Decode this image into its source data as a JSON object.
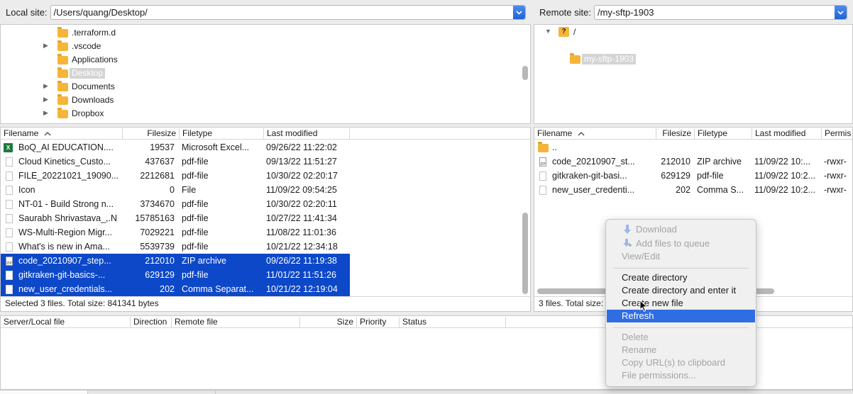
{
  "local": {
    "label": "Local site:",
    "path": "/Users/quang/Desktop/",
    "tree": [
      {
        "name": ".terraform.d",
        "expand": false,
        "selected": false
      },
      {
        "name": ".vscode",
        "expand": true,
        "selected": false
      },
      {
        "name": "Applications",
        "expand": false,
        "selected": false
      },
      {
        "name": "Desktop",
        "expand": false,
        "selected": true
      },
      {
        "name": "Documents",
        "expand": true,
        "selected": false
      },
      {
        "name": "Downloads",
        "expand": true,
        "selected": false
      },
      {
        "name": "Dropbox",
        "expand": true,
        "selected": false
      }
    ],
    "columns": {
      "filename": "Filename",
      "filesize": "Filesize",
      "filetype": "Filetype",
      "modified": "Last modified"
    },
    "files": [
      {
        "name": "BoQ_AI EDUCATION....",
        "size": "19537",
        "type": "Microsoft Excel...",
        "modified": "09/26/22 11:22:02",
        "icon": "excel-icon",
        "selected": false
      },
      {
        "name": "Cloud Kinetics_Custo...",
        "size": "437637",
        "type": "pdf-file",
        "modified": "09/13/22 11:51:27",
        "icon": "file-icon",
        "selected": false
      },
      {
        "name": "FILE_20221021_19090...",
        "size": "2212681",
        "type": "pdf-file",
        "modified": "10/30/22 02:20:17",
        "icon": "file-icon",
        "selected": false
      },
      {
        "name": "Icon",
        "size": "0",
        "type": "File",
        "modified": "11/09/22 09:54:25",
        "icon": "file-icon",
        "selected": false
      },
      {
        "name": "NT-01 - Build Strong n...",
        "size": "3734670",
        "type": "pdf-file",
        "modified": "10/30/22 02:20:11",
        "icon": "file-icon",
        "selected": false
      },
      {
        "name": "Saurabh Shrivastava_,.N",
        "size": "15785163",
        "type": "pdf-file",
        "modified": "10/27/22 11:41:34",
        "icon": "file-icon",
        "selected": false
      },
      {
        "name": "WS-Multi-Region Migr...",
        "size": "7029221",
        "type": "pdf-file",
        "modified": "11/08/22 11:01:36",
        "icon": "file-icon",
        "selected": false
      },
      {
        "name": "What's is new in Ama...",
        "size": "5539739",
        "type": "pdf-file",
        "modified": "10/21/22 12:34:18",
        "icon": "file-icon",
        "selected": false
      },
      {
        "name": "code_20210907_step...",
        "size": "212010",
        "type": "ZIP archive",
        "modified": "09/26/22 11:19:38",
        "icon": "zip-icon",
        "selected": true
      },
      {
        "name": "gitkraken-git-basics-...",
        "size": "629129",
        "type": "pdf-file",
        "modified": "11/01/22 11:51:26",
        "icon": "file-icon",
        "selected": true
      },
      {
        "name": "new_user_credentials...",
        "size": "202",
        "type": "Comma Separat...",
        "modified": "10/21/22 12:19:04",
        "icon": "file-icon",
        "selected": true
      }
    ],
    "status": "Selected 3 files. Total size: 841341 bytes"
  },
  "remote": {
    "label": "Remote site:",
    "path": "/my-sftp-1903",
    "tree_root": "/",
    "tree_child": "my-sftp-1903",
    "columns": {
      "filename": "Filename",
      "filesize": "Filesize",
      "filetype": "Filetype",
      "modified": "Last modified",
      "perms": "Permis"
    },
    "files": [
      {
        "name": "..",
        "size": "",
        "type": "",
        "modified": "",
        "perms": "",
        "icon": "folder-icon"
      },
      {
        "name": "code_20210907_st...",
        "size": "212010",
        "type": "ZIP archive",
        "modified": "11/09/22 10:...",
        "perms": "-rwxr-",
        "icon": "zip-icon"
      },
      {
        "name": "gitkraken-git-basi...",
        "size": "629129",
        "type": "pdf-file",
        "modified": "11/09/22 10:2...",
        "perms": "-rwxr-",
        "icon": "file-icon"
      },
      {
        "name": "new_user_credenti...",
        "size": "202",
        "type": "Comma S...",
        "modified": "11/09/22 10:2...",
        "perms": "-rwxr-",
        "icon": "file-icon"
      }
    ],
    "status": "3 files. Total size:"
  },
  "queue": {
    "columns": {
      "server": "Server/Local file",
      "direction": "Direction",
      "remote": "Remote file",
      "size": "Size",
      "priority": "Priority",
      "status": "Status"
    }
  },
  "context_menu": {
    "download": "Download",
    "add_queue": "Add files to queue",
    "view_edit": "View/Edit",
    "create_dir": "Create directory",
    "create_dir_enter": "Create directory and enter it",
    "create_file": "Create new file",
    "refresh": "Refresh",
    "delete": "Delete",
    "rename": "Rename",
    "copy_url": "Copy URL(s) to clipboard",
    "file_perms": "File permissions..."
  },
  "colors": {
    "selection": "#0d48c9",
    "menu_highlight": "#2f6de3",
    "folder": "#f5b53a"
  }
}
